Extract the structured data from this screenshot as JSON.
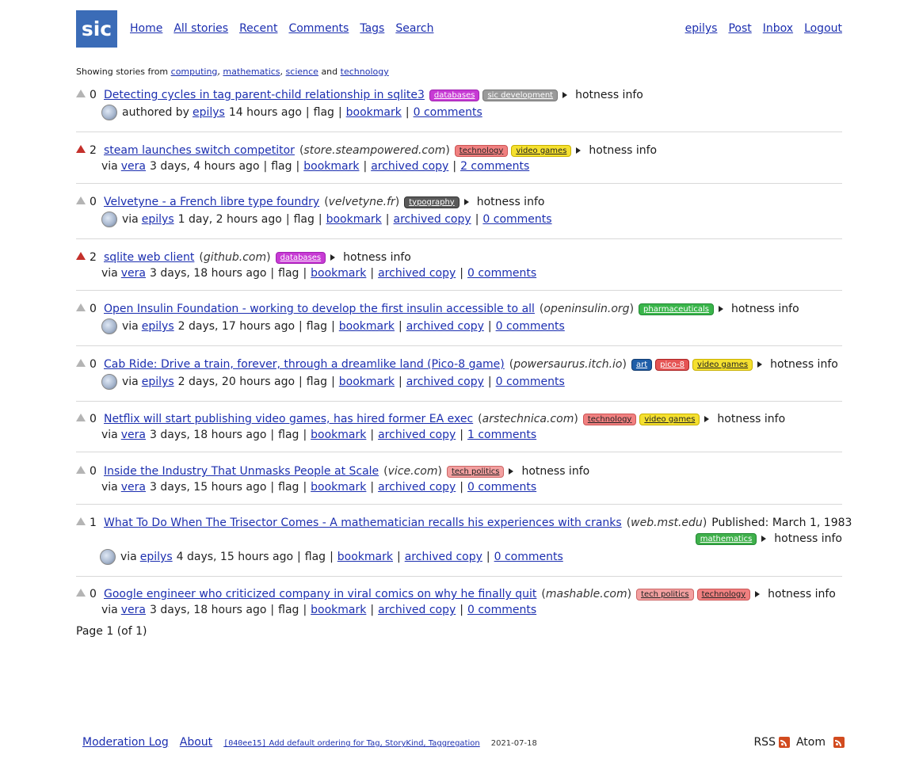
{
  "header": {
    "logo": "sic",
    "nav_left": [
      "Home",
      "All stories",
      "Recent",
      "Comments",
      "Tags",
      "Search"
    ],
    "nav_right": [
      "epilys",
      "Post",
      "Inbox",
      "Logout"
    ]
  },
  "filter": {
    "prefix": "Showing stories from",
    "tags": [
      "computing",
      "mathematics",
      "science",
      "technology"
    ],
    "conj": "and"
  },
  "labels": {
    "hotness": "hotness info",
    "authored_by": "authored by",
    "via": "via",
    "flag": "flag",
    "bookmark": "bookmark",
    "archived": "archived copy"
  },
  "stories": [
    {
      "score": "0",
      "voted": false,
      "title": "Detecting cycles in tag parent-child relationship in sqlite3",
      "domain": "",
      "tags": [
        {
          "name": "databases",
          "cls": "t-databases"
        },
        {
          "name": "sic development",
          "cls": "t-sic"
        }
      ],
      "byline": "authored by",
      "user": "epilys",
      "avatar": true,
      "time": "14 hours ago",
      "archived": false,
      "comments": "0 comments"
    },
    {
      "score": "2",
      "voted": true,
      "title": "steam launches switch competitor",
      "domain": "store.steampowered.com",
      "tags": [
        {
          "name": "technology",
          "cls": "t-technology"
        },
        {
          "name": "video games",
          "cls": "t-videogames"
        }
      ],
      "byline": "via",
      "user": "vera",
      "avatar": false,
      "time": "3 days, 4 hours ago",
      "archived": true,
      "comments": "2 comments"
    },
    {
      "score": "0",
      "voted": false,
      "title": "Velvetyne - a French libre type foundry",
      "domain": "velvetyne.fr",
      "tags": [
        {
          "name": "typography",
          "cls": "t-typography"
        }
      ],
      "byline": "via",
      "user": "epilys",
      "avatar": true,
      "time": "1 day, 2 hours ago",
      "archived": true,
      "comments": "0 comments"
    },
    {
      "score": "2",
      "voted": true,
      "title": "sqlite web client",
      "domain": "github.com",
      "tags": [
        {
          "name": "databases",
          "cls": "t-databases"
        }
      ],
      "byline": "via",
      "user": "vera",
      "avatar": false,
      "time": "3 days, 18 hours ago",
      "archived": true,
      "comments": "0 comments"
    },
    {
      "score": "0",
      "voted": false,
      "title": "Open Insulin Foundation - working to develop the first insulin accessible to all",
      "domain": "openinsulin.org",
      "tags": [
        {
          "name": "pharmaceuticals",
          "cls": "t-pharma"
        }
      ],
      "byline": "via",
      "user": "epilys",
      "avatar": true,
      "time": "2 days, 17 hours ago",
      "archived": true,
      "comments": "0 comments"
    },
    {
      "score": "0",
      "voted": false,
      "title": "Cab Ride: Drive a train, forever, through a dreamlike land (Pico-8 game)",
      "domain": "powersaurus.itch.io",
      "tags": [
        {
          "name": "art",
          "cls": "t-art"
        },
        {
          "name": "pico-8",
          "cls": "t-pico"
        },
        {
          "name": "video games",
          "cls": "t-videogames"
        }
      ],
      "byline": "via",
      "user": "epilys",
      "avatar": true,
      "time": "2 days, 20 hours ago",
      "archived": true,
      "comments": "0 comments"
    },
    {
      "score": "0",
      "voted": false,
      "title": "Netflix will start publishing video games, has hired former EA exec",
      "domain": "arstechnica.com",
      "tags": [
        {
          "name": "technology",
          "cls": "t-technology"
        },
        {
          "name": "video games",
          "cls": "t-videogames"
        }
      ],
      "byline": "via",
      "user": "vera",
      "avatar": false,
      "time": "3 days, 18 hours ago",
      "archived": true,
      "comments": "1 comments"
    },
    {
      "score": "0",
      "voted": false,
      "title": "Inside the Industry That Unmasks People at Scale",
      "domain": "vice.com",
      "tags": [
        {
          "name": "tech politics",
          "cls": "t-techpolitics"
        }
      ],
      "byline": "via",
      "user": "vera",
      "avatar": false,
      "time": "3 days, 15 hours ago",
      "archived": true,
      "comments": "0 comments"
    },
    {
      "score": "1",
      "voted": false,
      "title": "What To Do When The Trisector Comes - A mathematician recalls his experiences with cranks",
      "domain": "web.mst.edu",
      "published": "Published: March 1, 1983",
      "tags": [
        {
          "name": "mathematics",
          "cls": "t-math"
        }
      ],
      "byline": "via",
      "user": "epilys",
      "avatar": true,
      "time": "4 days, 15 hours ago",
      "archived": true,
      "comments": "0 comments"
    },
    {
      "score": "0",
      "voted": false,
      "title": "Google engineer who criticized company in viral comics on why he finally quit",
      "domain": "mashable.com",
      "tags": [
        {
          "name": "tech politics",
          "cls": "t-techpolitics"
        },
        {
          "name": "technology",
          "cls": "t-technology"
        }
      ],
      "byline": "via",
      "user": "vera",
      "avatar": false,
      "time": "3 days, 18 hours ago",
      "archived": true,
      "comments": "0 comments"
    }
  ],
  "page_info": "Page 1 (of 1)",
  "footer": {
    "links": [
      "Moderation Log",
      "About"
    ],
    "commit_hash": "[040ee15]",
    "commit_msg": "Add default ordering for Tag, StoryKind, Taggregation",
    "commit_date": "2021-07-18",
    "feeds": [
      "RSS",
      "Atom"
    ]
  }
}
